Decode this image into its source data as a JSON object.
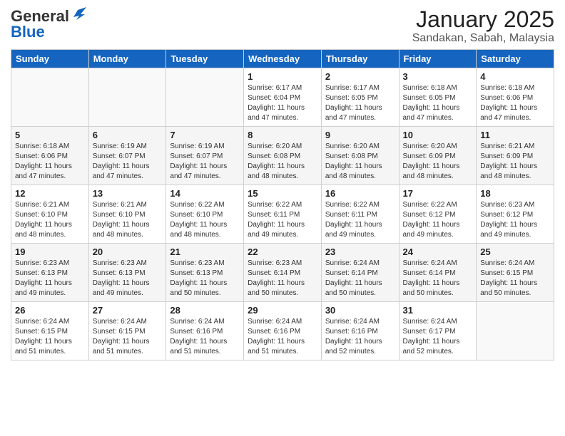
{
  "header": {
    "logo_general": "General",
    "logo_blue": "Blue",
    "month_title": "January 2025",
    "location": "Sandakan, Sabah, Malaysia"
  },
  "weekdays": [
    "Sunday",
    "Monday",
    "Tuesday",
    "Wednesday",
    "Thursday",
    "Friday",
    "Saturday"
  ],
  "weeks": [
    [
      {
        "day": "",
        "text": ""
      },
      {
        "day": "",
        "text": ""
      },
      {
        "day": "",
        "text": ""
      },
      {
        "day": "1",
        "text": "Sunrise: 6:17 AM\nSunset: 6:04 PM\nDaylight: 11 hours and 47 minutes."
      },
      {
        "day": "2",
        "text": "Sunrise: 6:17 AM\nSunset: 6:05 PM\nDaylight: 11 hours and 47 minutes."
      },
      {
        "day": "3",
        "text": "Sunrise: 6:18 AM\nSunset: 6:05 PM\nDaylight: 11 hours and 47 minutes."
      },
      {
        "day": "4",
        "text": "Sunrise: 6:18 AM\nSunset: 6:06 PM\nDaylight: 11 hours and 47 minutes."
      }
    ],
    [
      {
        "day": "5",
        "text": "Sunrise: 6:18 AM\nSunset: 6:06 PM\nDaylight: 11 hours and 47 minutes."
      },
      {
        "day": "6",
        "text": "Sunrise: 6:19 AM\nSunset: 6:07 PM\nDaylight: 11 hours and 47 minutes."
      },
      {
        "day": "7",
        "text": "Sunrise: 6:19 AM\nSunset: 6:07 PM\nDaylight: 11 hours and 47 minutes."
      },
      {
        "day": "8",
        "text": "Sunrise: 6:20 AM\nSunset: 6:08 PM\nDaylight: 11 hours and 48 minutes."
      },
      {
        "day": "9",
        "text": "Sunrise: 6:20 AM\nSunset: 6:08 PM\nDaylight: 11 hours and 48 minutes."
      },
      {
        "day": "10",
        "text": "Sunrise: 6:20 AM\nSunset: 6:09 PM\nDaylight: 11 hours and 48 minutes."
      },
      {
        "day": "11",
        "text": "Sunrise: 6:21 AM\nSunset: 6:09 PM\nDaylight: 11 hours and 48 minutes."
      }
    ],
    [
      {
        "day": "12",
        "text": "Sunrise: 6:21 AM\nSunset: 6:10 PM\nDaylight: 11 hours and 48 minutes."
      },
      {
        "day": "13",
        "text": "Sunrise: 6:21 AM\nSunset: 6:10 PM\nDaylight: 11 hours and 48 minutes."
      },
      {
        "day": "14",
        "text": "Sunrise: 6:22 AM\nSunset: 6:10 PM\nDaylight: 11 hours and 48 minutes."
      },
      {
        "day": "15",
        "text": "Sunrise: 6:22 AM\nSunset: 6:11 PM\nDaylight: 11 hours and 49 minutes."
      },
      {
        "day": "16",
        "text": "Sunrise: 6:22 AM\nSunset: 6:11 PM\nDaylight: 11 hours and 49 minutes."
      },
      {
        "day": "17",
        "text": "Sunrise: 6:22 AM\nSunset: 6:12 PM\nDaylight: 11 hours and 49 minutes."
      },
      {
        "day": "18",
        "text": "Sunrise: 6:23 AM\nSunset: 6:12 PM\nDaylight: 11 hours and 49 minutes."
      }
    ],
    [
      {
        "day": "19",
        "text": "Sunrise: 6:23 AM\nSunset: 6:13 PM\nDaylight: 11 hours and 49 minutes."
      },
      {
        "day": "20",
        "text": "Sunrise: 6:23 AM\nSunset: 6:13 PM\nDaylight: 11 hours and 49 minutes."
      },
      {
        "day": "21",
        "text": "Sunrise: 6:23 AM\nSunset: 6:13 PM\nDaylight: 11 hours and 50 minutes."
      },
      {
        "day": "22",
        "text": "Sunrise: 6:23 AM\nSunset: 6:14 PM\nDaylight: 11 hours and 50 minutes."
      },
      {
        "day": "23",
        "text": "Sunrise: 6:24 AM\nSunset: 6:14 PM\nDaylight: 11 hours and 50 minutes."
      },
      {
        "day": "24",
        "text": "Sunrise: 6:24 AM\nSunset: 6:14 PM\nDaylight: 11 hours and 50 minutes."
      },
      {
        "day": "25",
        "text": "Sunrise: 6:24 AM\nSunset: 6:15 PM\nDaylight: 11 hours and 50 minutes."
      }
    ],
    [
      {
        "day": "26",
        "text": "Sunrise: 6:24 AM\nSunset: 6:15 PM\nDaylight: 11 hours and 51 minutes."
      },
      {
        "day": "27",
        "text": "Sunrise: 6:24 AM\nSunset: 6:15 PM\nDaylight: 11 hours and 51 minutes."
      },
      {
        "day": "28",
        "text": "Sunrise: 6:24 AM\nSunset: 6:16 PM\nDaylight: 11 hours and 51 minutes."
      },
      {
        "day": "29",
        "text": "Sunrise: 6:24 AM\nSunset: 6:16 PM\nDaylight: 11 hours and 51 minutes."
      },
      {
        "day": "30",
        "text": "Sunrise: 6:24 AM\nSunset: 6:16 PM\nDaylight: 11 hours and 52 minutes."
      },
      {
        "day": "31",
        "text": "Sunrise: 6:24 AM\nSunset: 6:17 PM\nDaylight: 11 hours and 52 minutes."
      },
      {
        "day": "",
        "text": ""
      }
    ]
  ]
}
